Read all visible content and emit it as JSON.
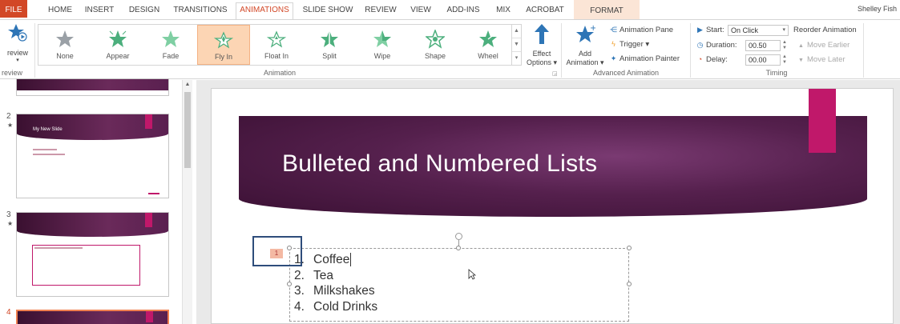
{
  "tabs": [
    "FILE",
    "HOME",
    "INSERT",
    "DESIGN",
    "TRANSITIONS",
    "ANIMATIONS",
    "SLIDE SHOW",
    "REVIEW",
    "VIEW",
    "ADD-INS",
    "MIX",
    "ACROBAT",
    "FORMAT"
  ],
  "active_tab": "ANIMATIONS",
  "user_name": "Shelley Fish",
  "ribbon": {
    "preview": {
      "label": "review",
      "group": "review"
    },
    "animation_group_label": "Animation",
    "effects": [
      {
        "label": "None"
      },
      {
        "label": "Appear"
      },
      {
        "label": "Fade"
      },
      {
        "label": "Fly In",
        "selected": true
      },
      {
        "label": "Float In"
      },
      {
        "label": "Split"
      },
      {
        "label": "Wipe"
      },
      {
        "label": "Shape"
      },
      {
        "label": "Wheel"
      }
    ],
    "effect_options": {
      "line1": "Effect",
      "line2": "Options ▾"
    },
    "advanced": {
      "group_label": "Advanced Animation",
      "add_animation_line1": "Add",
      "add_animation_line2": "Animation ▾",
      "animation_pane": "Animation Pane",
      "trigger": "Trigger ▾",
      "animation_painter": "Animation Painter"
    },
    "timing": {
      "group_label": "Timing",
      "start_label": "Start:",
      "start_value": "On Click",
      "duration_label": "Duration:",
      "duration_value": "00.50",
      "delay_label": "Delay:",
      "delay_value": "00.00",
      "reorder_title": "Reorder Animation",
      "move_earlier": "Move Earlier",
      "move_later": "Move Later"
    }
  },
  "thumbnails": [
    {
      "number": "2",
      "title": "My New Slide"
    },
    {
      "number": "3"
    },
    {
      "number": "4"
    }
  ],
  "slide": {
    "title": "Bulleted and Numbered Lists",
    "animation_tag": "1",
    "list": [
      {
        "num": "1.",
        "text": "Coffee"
      },
      {
        "num": "2.",
        "text": "Tea"
      },
      {
        "num": "3.",
        "text": "Milkshakes"
      },
      {
        "num": "4.",
        "text": "Cold Drinks"
      }
    ]
  },
  "colors": {
    "file_tab": "#d24726",
    "accent": "#c0186a",
    "banner": "#55204d"
  }
}
